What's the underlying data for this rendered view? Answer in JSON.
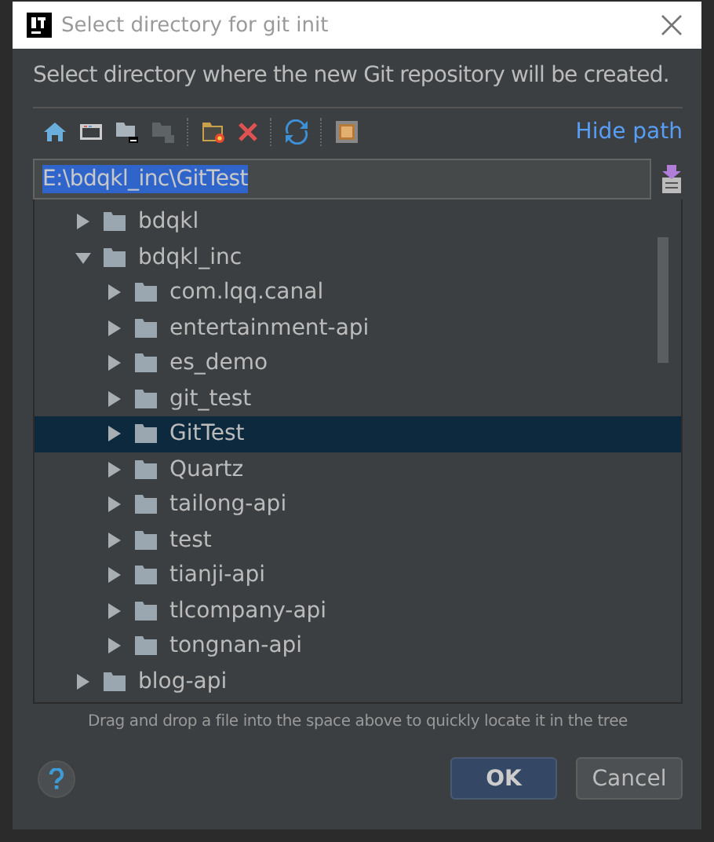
{
  "window": {
    "title": "Select directory for git init"
  },
  "description": "Select directory where the new Git repository will be created.",
  "toolbar": {
    "hide_path_link": "Hide path"
  },
  "path_field": {
    "value": "E:\\bdqkl_inc\\GitTest",
    "text_selected": true
  },
  "tree": [
    {
      "label": "bdqkl",
      "expanded": false,
      "selected": false
    },
    {
      "label": "bdqkl_inc",
      "expanded": true,
      "selected": false,
      "children": [
        {
          "label": "com.lqq.canal",
          "expanded": false,
          "selected": false
        },
        {
          "label": "entertainment-api",
          "expanded": false,
          "selected": false
        },
        {
          "label": "es_demo",
          "expanded": false,
          "selected": false
        },
        {
          "label": "git_test",
          "expanded": false,
          "selected": false
        },
        {
          "label": "GitTest",
          "expanded": false,
          "selected": true
        },
        {
          "label": "Quartz",
          "expanded": false,
          "selected": false
        },
        {
          "label": "tailong-api",
          "expanded": false,
          "selected": false
        },
        {
          "label": "test",
          "expanded": false,
          "selected": false
        },
        {
          "label": "tianji-api",
          "expanded": false,
          "selected": false
        },
        {
          "label": "tlcompany-api",
          "expanded": false,
          "selected": false
        },
        {
          "label": "tongnan-api",
          "expanded": false,
          "selected": false
        }
      ]
    },
    {
      "label": "blog-api",
      "expanded": false,
      "selected": false
    }
  ],
  "hint": "Drag and drop a file into the space above to quickly locate it in the tree",
  "buttons": [
    {
      "label": "OK",
      "default": true
    },
    {
      "label": "Cancel",
      "default": false
    }
  ]
}
